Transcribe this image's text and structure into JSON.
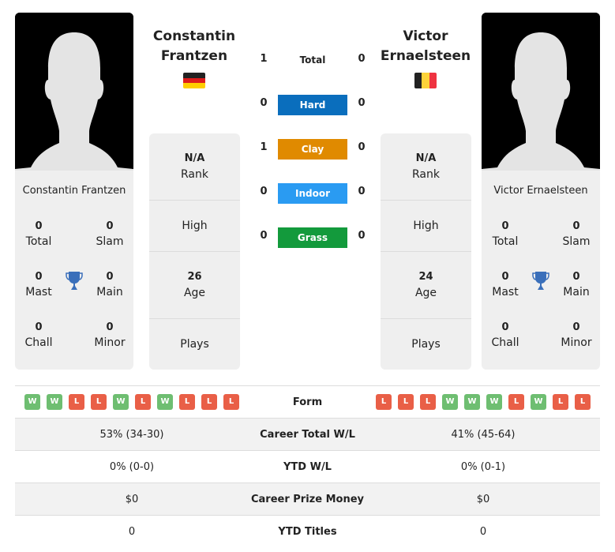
{
  "colors": {
    "hard": "#0a6ebd",
    "clay": "#e08a00",
    "indoor": "#2a9bf2",
    "grass": "#139a3c",
    "form_win": "#6ebe71",
    "form_loss": "#e95f47",
    "trophy": "#3a6fba"
  },
  "player1": {
    "name_line1": "Constantin",
    "name_line2": "Frantzen",
    "full_name": "Constantin Frantzen",
    "flag": "germany-flag",
    "titles": {
      "total": "0",
      "total_label": "Total",
      "slam": "0",
      "slam_label": "Slam",
      "mast": "0",
      "mast_label": "Mast",
      "main": "0",
      "main_label": "Main",
      "chall": "0",
      "chall_label": "Chall",
      "minor": "0",
      "minor_label": "Minor"
    },
    "info": {
      "rank": "N/A",
      "rank_label": "Rank",
      "high_label": "High",
      "age": "26",
      "age_label": "Age",
      "plays_label": "Plays"
    }
  },
  "player2": {
    "name_line1": "Victor",
    "name_line2": "Ernaelsteen",
    "full_name": "Victor Ernaelsteen",
    "flag": "belgium-flag",
    "titles": {
      "total": "0",
      "total_label": "Total",
      "slam": "0",
      "slam_label": "Slam",
      "mast": "0",
      "mast_label": "Mast",
      "main": "0",
      "main_label": "Main",
      "chall": "0",
      "chall_label": "Chall",
      "minor": "0",
      "minor_label": "Minor"
    },
    "info": {
      "rank": "N/A",
      "rank_label": "Rank",
      "high_label": "High",
      "age": "24",
      "age_label": "Age",
      "plays_label": "Plays"
    }
  },
  "h2h": {
    "total": {
      "label": "Total",
      "p1": "1",
      "p2": "0"
    },
    "hard": {
      "label": "Hard",
      "p1": "0",
      "p2": "0"
    },
    "clay": {
      "label": "Clay",
      "p1": "1",
      "p2": "0"
    },
    "indoor": {
      "label": "Indoor",
      "p1": "0",
      "p2": "0"
    },
    "grass": {
      "label": "Grass",
      "p1": "0",
      "p2": "0"
    }
  },
  "comparison": {
    "form": {
      "label": "Form",
      "p1": [
        "W",
        "W",
        "L",
        "L",
        "W",
        "L",
        "W",
        "L",
        "L",
        "L"
      ],
      "p2": [
        "L",
        "L",
        "L",
        "W",
        "W",
        "W",
        "L",
        "W",
        "L",
        "L"
      ]
    },
    "rows": [
      {
        "label": "Career Total W/L",
        "p1": "53% (34-30)",
        "p2": "41% (45-64)"
      },
      {
        "label": "YTD W/L",
        "p1": "0% (0-0)",
        "p2": "0% (0-1)"
      },
      {
        "label": "Career Prize Money",
        "p1": "$0",
        "p2": "$0"
      },
      {
        "label": "YTD Titles",
        "p1": "0",
        "p2": "0"
      }
    ]
  }
}
